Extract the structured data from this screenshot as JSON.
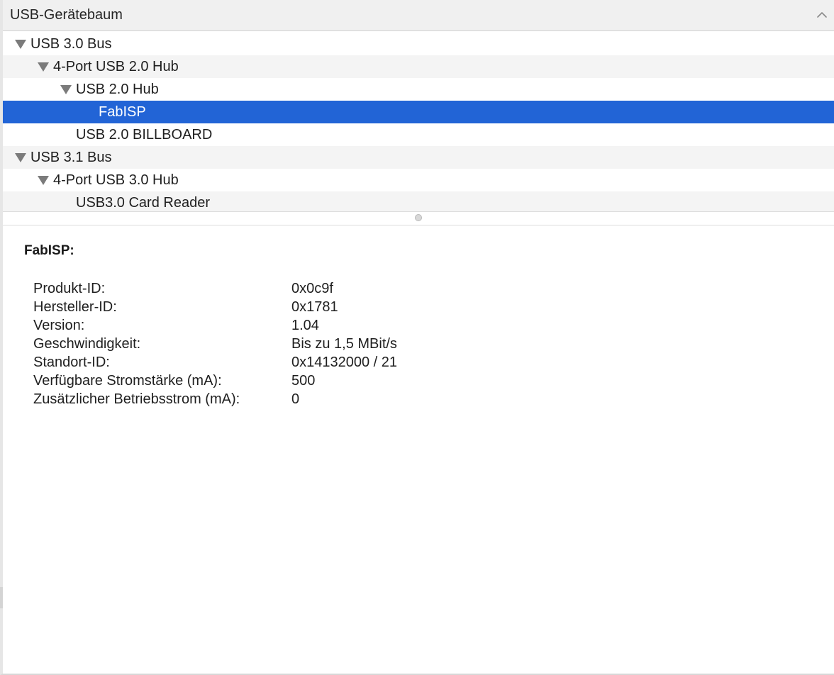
{
  "header": {
    "title": "USB-Gerätebaum"
  },
  "tree": {
    "rows": [
      {
        "label": "USB 3.0 Bus",
        "level": 0,
        "expanded": true,
        "selected": false
      },
      {
        "label": "4-Port USB 2.0 Hub",
        "level": 1,
        "expanded": true,
        "selected": false
      },
      {
        "label": "USB 2.0 Hub",
        "level": 2,
        "expanded": true,
        "selected": false
      },
      {
        "label": "FabISP",
        "level": 3,
        "expanded": null,
        "selected": true
      },
      {
        "label": "USB 2.0 BILLBOARD",
        "level": 2,
        "expanded": null,
        "selected": false
      },
      {
        "label": "USB 3.1 Bus",
        "level": 0,
        "expanded": true,
        "selected": false
      },
      {
        "label": "4-Port USB 3.0 Hub",
        "level": 1,
        "expanded": true,
        "selected": false
      },
      {
        "label": "USB3.0 Card Reader",
        "level": 2,
        "expanded": null,
        "selected": false
      }
    ]
  },
  "details": {
    "title": "FabISP:",
    "properties": [
      {
        "key": "Produkt-ID:",
        "value": "0x0c9f"
      },
      {
        "key": "Hersteller-ID:",
        "value": "0x1781"
      },
      {
        "key": "Version:",
        "value": "1.04"
      },
      {
        "key": "Geschwindigkeit:",
        "value": "Bis zu 1,5 MBit/s"
      },
      {
        "key": "Standort-ID:",
        "value": "0x14132000 / 21"
      },
      {
        "key": "Verfügbare Stromstärke (mA):",
        "value": "500"
      },
      {
        "key": "Zusätzlicher Betriebsstrom (mA):",
        "value": "0"
      }
    ]
  },
  "colors": {
    "selection": "#2264d6",
    "header_bg": "#f0f0f0",
    "alt_row": "#f4f4f4"
  },
  "icons": {
    "collapse": "chevron-up-icon",
    "disclosure": "disclosure-triangle-icon",
    "divider": "split-handle-icon"
  }
}
